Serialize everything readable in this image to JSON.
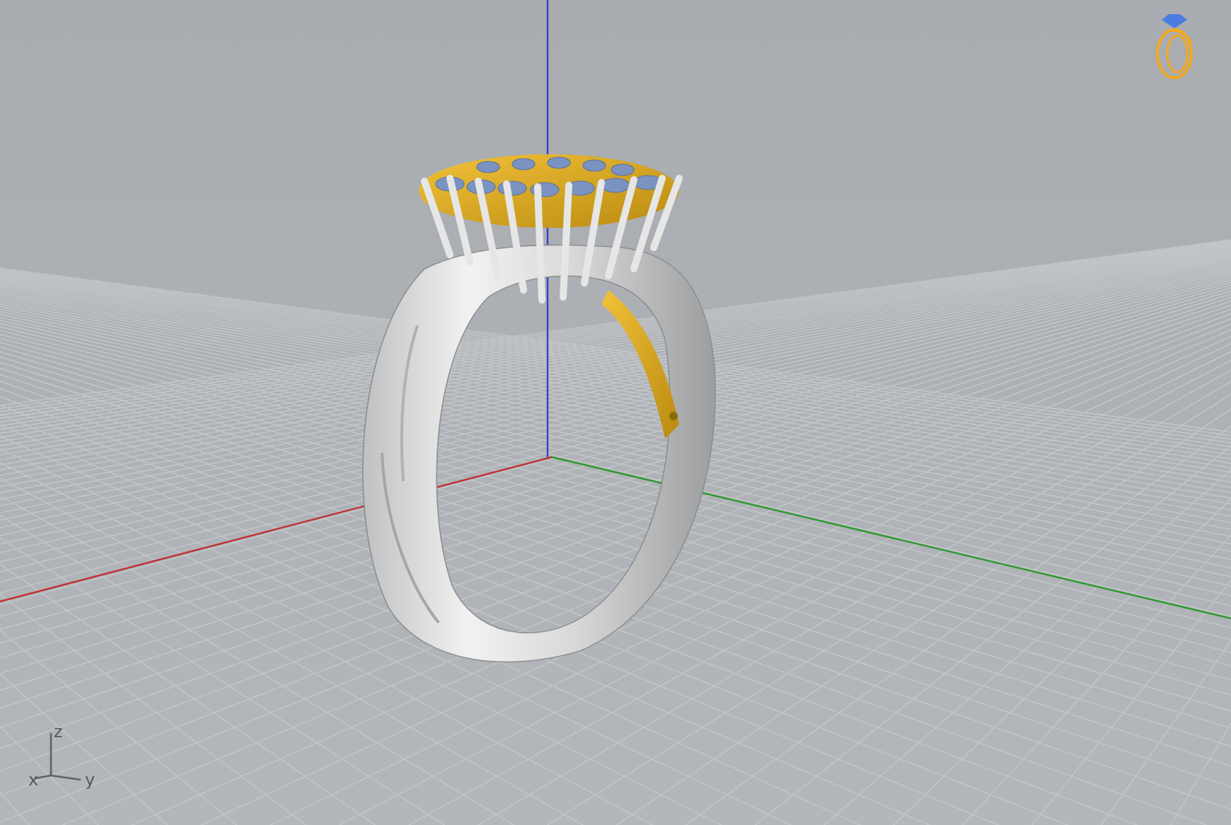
{
  "viewport": {
    "axis_indicator": {
      "labels": [
        {
          "kind": "z",
          "label": "z"
        },
        {
          "kind": "x",
          "label": "x"
        },
        {
          "kind": "y",
          "label": "y"
        }
      ]
    }
  }
}
